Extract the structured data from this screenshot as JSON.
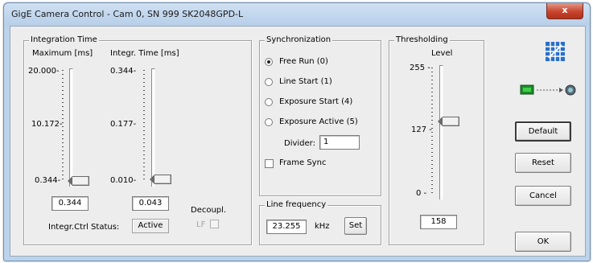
{
  "window": {
    "title": "GigE Camera Control - Cam 0, SN 999   SK2048GPD-L",
    "close_label": "x"
  },
  "integration": {
    "group_title": "Integration Time",
    "max_label": "Maximum [ms]",
    "int_label": "Integr. Time [ms]",
    "max_ticks": [
      "20.000-",
      "10.172-",
      "0.344-"
    ],
    "int_ticks": [
      "0.344-",
      "0.177-",
      "0.010-"
    ],
    "max_value": "0.344",
    "int_value": "0.043",
    "status_label": "Integr.Ctrl Status:",
    "status_value": "Active",
    "decoupl_label": "Decoupl.",
    "lf_label": "LF"
  },
  "sync": {
    "group_title": "Synchronization",
    "radios": [
      {
        "label": "Free Run (0)",
        "checked": true
      },
      {
        "label": "Line Start (1)",
        "checked": false
      },
      {
        "label": "Exposure Start  (4)",
        "checked": false
      },
      {
        "label": "Exposure Active (5)",
        "checked": false
      }
    ],
    "divider_label": "Divider:",
    "divider_value": "1",
    "frame_sync_label": "Frame Sync"
  },
  "linefreq": {
    "group_title": "Line frequency",
    "value": "23.255",
    "unit": "kHz",
    "set_label": "Set"
  },
  "threshold": {
    "group_title": "Thresholding",
    "level_label": "Level",
    "ticks": [
      "255 -",
      "127 -",
      "0 -"
    ],
    "value": "158"
  },
  "buttons": {
    "default": "Default",
    "reset": "Reset",
    "cancel": "Cancel",
    "ok": "OK"
  },
  "colors": {
    "logo": "#2a6fc9",
    "chip": "#1f8a2a"
  }
}
